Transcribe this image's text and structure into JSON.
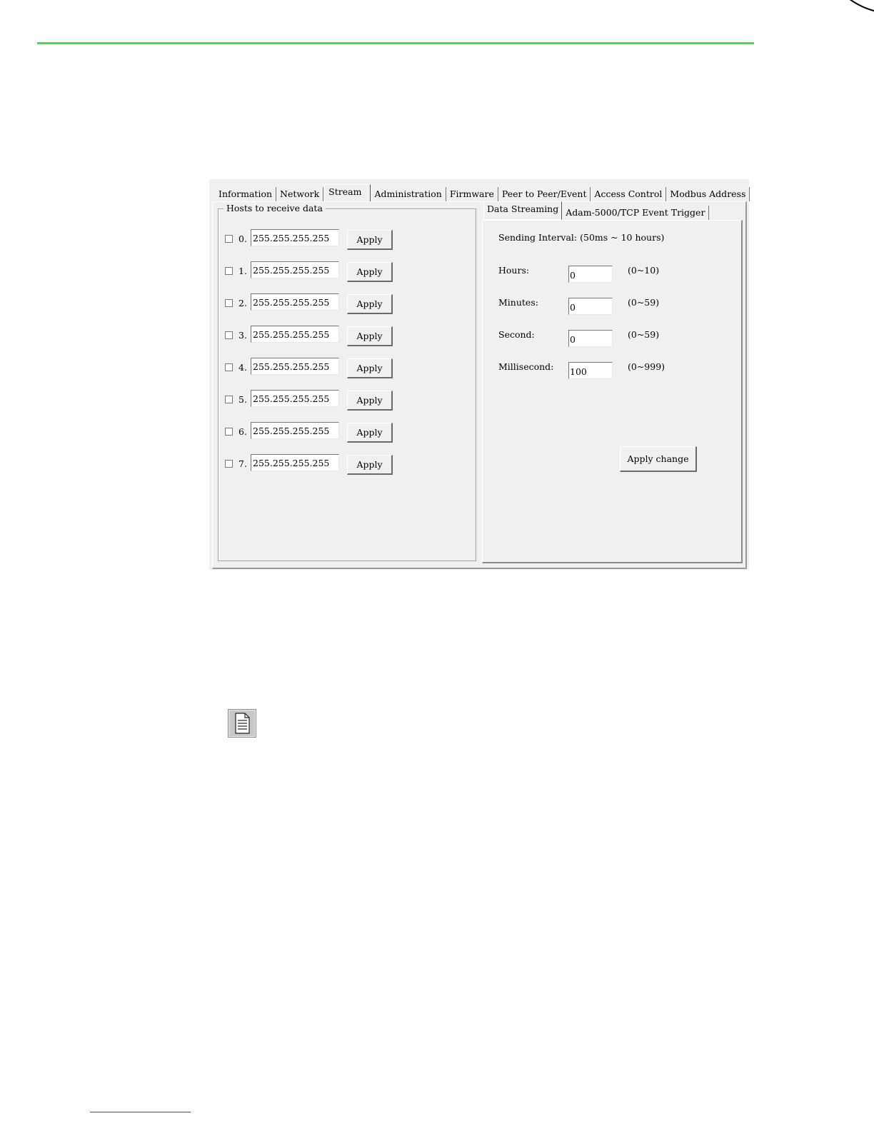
{
  "tabs": [
    "Information",
    "Network",
    "Stream",
    "Administration",
    "Firmware",
    "Peer to Peer/Event",
    "Access Control",
    "Modbus Address"
  ],
  "active_tab": "Stream",
  "hosts_group": {
    "title": "Hosts to receive data",
    "hosts": [
      {
        "index": "0.",
        "ip": "255.255.255.255",
        "apply": "Apply"
      },
      {
        "index": "1.",
        "ip": "255.255.255.255",
        "apply": "Apply"
      },
      {
        "index": "2.",
        "ip": "255.255.255.255",
        "apply": "Apply"
      },
      {
        "index": "3.",
        "ip": "255.255.255.255",
        "apply": "Apply"
      },
      {
        "index": "4.",
        "ip": "255.255.255.255",
        "apply": "Apply"
      },
      {
        "index": "5.",
        "ip": "255.255.255.255",
        "apply": "Apply"
      },
      {
        "index": "6.",
        "ip": "255.255.255.255",
        "apply": "Apply"
      },
      {
        "index": "7.",
        "ip": "255.255.255.255",
        "apply": "Apply"
      }
    ]
  },
  "sub_tabs": [
    "Data Streaming",
    "Adam-5000/TCP Event Trigger"
  ],
  "streaming": {
    "interval_title": "Sending Interval: (50ms ~ 10 hours)",
    "fields": [
      {
        "label": "Hours:",
        "value": "0",
        "range": "(0~10)"
      },
      {
        "label": "Minutes:",
        "value": "0",
        "range": "(0~59)"
      },
      {
        "label": "Second:",
        "value": "0",
        "range": "(0~59)"
      },
      {
        "label": "Millisecond:",
        "value": "100",
        "range": "(0~999)"
      }
    ],
    "apply_change": "Apply change"
  },
  "note_icon": "document-note-icon"
}
